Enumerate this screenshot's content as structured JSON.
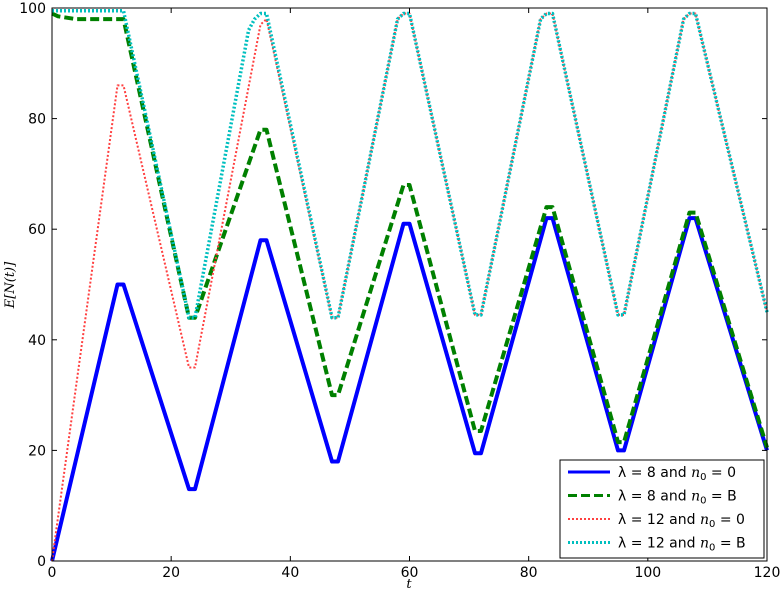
{
  "chart_data": {
    "type": "line",
    "xlabel": "t",
    "ylabel": "E[N(t)]",
    "xlim": [
      0,
      120
    ],
    "ylim": [
      0,
      100
    ],
    "xticks": [
      0,
      20,
      40,
      60,
      80,
      100,
      120
    ],
    "yticks": [
      0,
      20,
      40,
      60,
      80,
      100
    ],
    "grid": false,
    "legend_position": "lower-right",
    "series": [
      {
        "name": "λ = 8 and n₀ = 0",
        "color": "#0000ff",
        "style": "solid",
        "x": [
          0,
          11,
          12,
          23,
          24,
          35,
          36,
          47,
          48,
          59,
          60,
          71,
          72,
          83,
          84,
          95,
          96,
          107,
          108,
          120
        ],
        "y": [
          0,
          50,
          50,
          13,
          13,
          58,
          58,
          18,
          18,
          61,
          61,
          19.5,
          19.5,
          62,
          62,
          20,
          20,
          62,
          62,
          20
        ]
      },
      {
        "name": "λ = 8 and n₀ = B",
        "color": "#008000",
        "style": "dashed",
        "x": [
          0,
          1,
          4,
          12,
          23,
          24,
          35,
          36,
          47,
          48,
          59,
          60,
          71,
          72,
          83,
          84,
          95,
          96,
          107,
          108,
          120
        ],
        "y": [
          99,
          98.5,
          98,
          98,
          44,
          44,
          78,
          78,
          30,
          30,
          68,
          68,
          23.5,
          23.5,
          64,
          64,
          21.5,
          21.5,
          63,
          63,
          20.5
        ]
      },
      {
        "name": "λ = 12 and n₀ = 0",
        "color": "#ff4040",
        "style": "dotted",
        "x": [
          0,
          11,
          12,
          23,
          24,
          35,
          36,
          47,
          48,
          58,
          59,
          60,
          71,
          72,
          82,
          83,
          84,
          95,
          96,
          106,
          107,
          108,
          120
        ],
        "y": [
          0,
          86,
          86,
          35,
          35,
          97,
          98,
          44,
          44,
          98,
          99,
          99,
          44.5,
          44.5,
          98,
          99,
          99,
          44.5,
          44.5,
          98,
          99,
          99,
          45
        ]
      },
      {
        "name": "λ = 12 and n₀ = B",
        "color": "#00bfbf",
        "style": "dotted",
        "x": [
          0,
          12,
          23,
          24,
          33,
          34,
          35,
          36,
          47,
          48,
          58,
          59,
          60,
          71,
          72,
          82,
          83,
          84,
          95,
          96,
          106,
          107,
          108,
          120
        ],
        "y": [
          99.5,
          99.5,
          44,
          44,
          96,
          98,
          99,
          99,
          44,
          44,
          98,
          99,
          99,
          44.5,
          44.5,
          98,
          99,
          99,
          44.5,
          44.5,
          98,
          99,
          99,
          45
        ]
      }
    ],
    "legend": [
      {
        "prefix": "λ = 8 and ",
        "var": "n",
        "sub": "0",
        "suffix": " = 0"
      },
      {
        "prefix": "λ = 8 and ",
        "var": "n",
        "sub": "0",
        "suffix": " = B"
      },
      {
        "prefix": "λ = 12 and ",
        "var": "n",
        "sub": "0",
        "suffix": " = 0"
      },
      {
        "prefix": "λ = 12 and ",
        "var": "n",
        "sub": "0",
        "suffix": " = B"
      }
    ]
  }
}
